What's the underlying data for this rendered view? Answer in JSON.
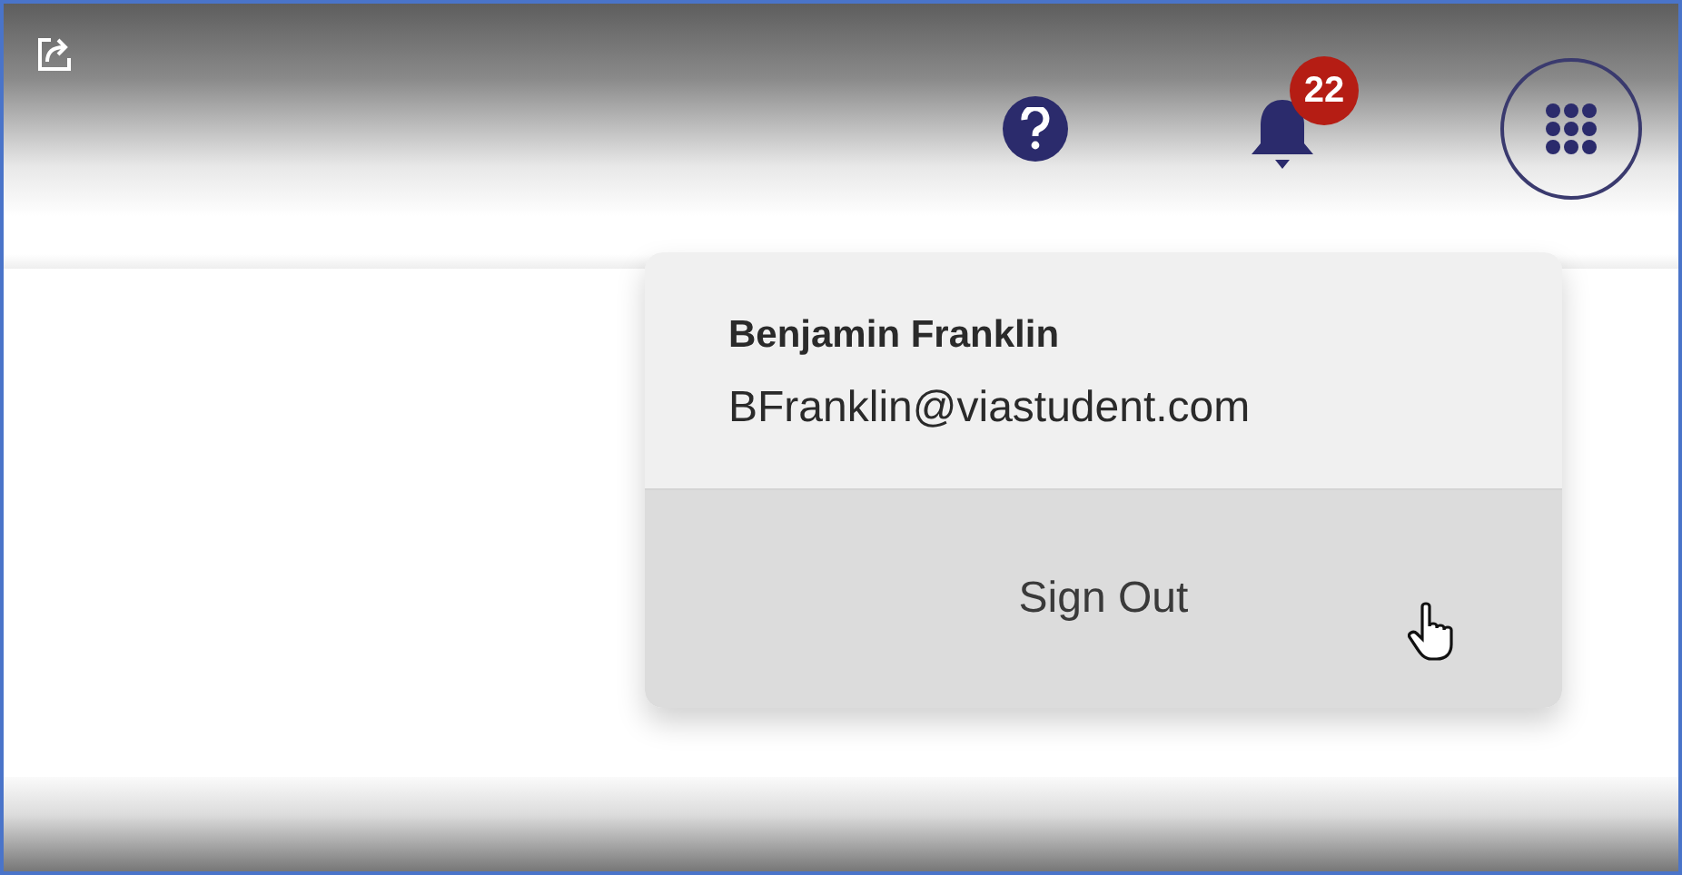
{
  "header": {
    "notification_count": "22"
  },
  "user_menu": {
    "name": "Benjamin Franklin",
    "email": "BFranklin@viastudent.com",
    "items": [
      {
        "label": "Sign Out",
        "hovered": true
      }
    ]
  }
}
